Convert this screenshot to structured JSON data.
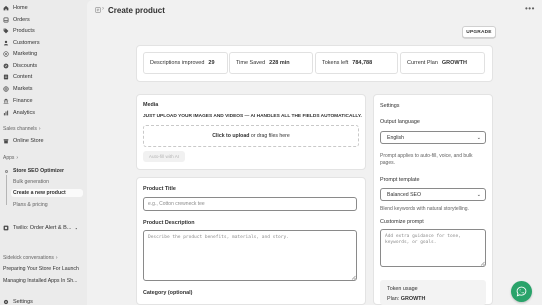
{
  "sidebar": {
    "items": [
      {
        "label": "Home",
        "icon": "home-icon"
      },
      {
        "label": "Orders",
        "icon": "orders-icon"
      },
      {
        "label": "Products",
        "icon": "tag-icon"
      },
      {
        "label": "Customers",
        "icon": "person-icon"
      },
      {
        "label": "Marketing",
        "icon": "target-icon"
      },
      {
        "label": "Discounts",
        "icon": "discount-icon"
      },
      {
        "label": "Content",
        "icon": "content-icon"
      },
      {
        "label": "Markets",
        "icon": "globe-icon"
      },
      {
        "label": "Finance",
        "icon": "bank-icon"
      },
      {
        "label": "Analytics",
        "icon": "chart-icon"
      }
    ],
    "sales_channels_label": "Sales channels",
    "online_store_label": "Online Store",
    "apps_label": "Apps",
    "app_items": [
      {
        "label": "Store SEO Optimizer"
      },
      {
        "label": "Bulk generation"
      },
      {
        "label": "Create a new product"
      },
      {
        "label": "Plans & pricing"
      }
    ],
    "twilio_label": "Twilio: Order Alert & B...",
    "sidekick_label": "Sidekick conversations",
    "sidekick_items": [
      {
        "label": "Preparing Your Store For Launch"
      },
      {
        "label": "Managing Installed Apps In Sh..."
      }
    ],
    "settings_label": "Settings"
  },
  "header": {
    "title": "Create product",
    "upgrade_label": "UPGRADE"
  },
  "stats": [
    {
      "label": "Descriptions improved",
      "value": "29"
    },
    {
      "label": "Time Saved",
      "value": "228 min"
    },
    {
      "label": "Tokens left",
      "value": "784,788"
    },
    {
      "label": "Current Plan",
      "value": "GROWTH"
    }
  ],
  "media": {
    "title": "Media",
    "instructions": "JUST UPLOAD YOUR IMAGES AND VIDEOS — AI HANDLES ALL THE FIELDS AUTOMATICALLY.",
    "upload_link": "Click to upload",
    "upload_rest": "or drag files here",
    "autofill_label": "Auto-fill with AI"
  },
  "product": {
    "title_label": "Product Title",
    "title_placeholder": "e.g., Cotton crewneck tee",
    "description_label": "Product Description",
    "description_placeholder": "Describe the product benefits, materials, and story.",
    "category_label": "Category (optional)"
  },
  "settings": {
    "title": "Settings",
    "output_language_label": "Output language",
    "output_language_value": "English",
    "output_language_hint": "Prompt applies to auto-fill, voice, and bulk pages.",
    "prompt_template_label": "Prompt template",
    "prompt_template_value": "Balanced SEO",
    "prompt_template_hint": "Blend keywords with natural storytelling.",
    "customize_prompt_label": "Customize prompt",
    "customize_prompt_placeholder": "Add extra guidance for tone, keywords, or goals.",
    "token_usage_label": "Token usage",
    "plan_prefix": "Plan:",
    "plan_value": "GROWTH"
  },
  "colors": {
    "accent_green": "#29a36a",
    "sidebar_bg": "#ebebeb",
    "card_bg": "#ffffff"
  }
}
